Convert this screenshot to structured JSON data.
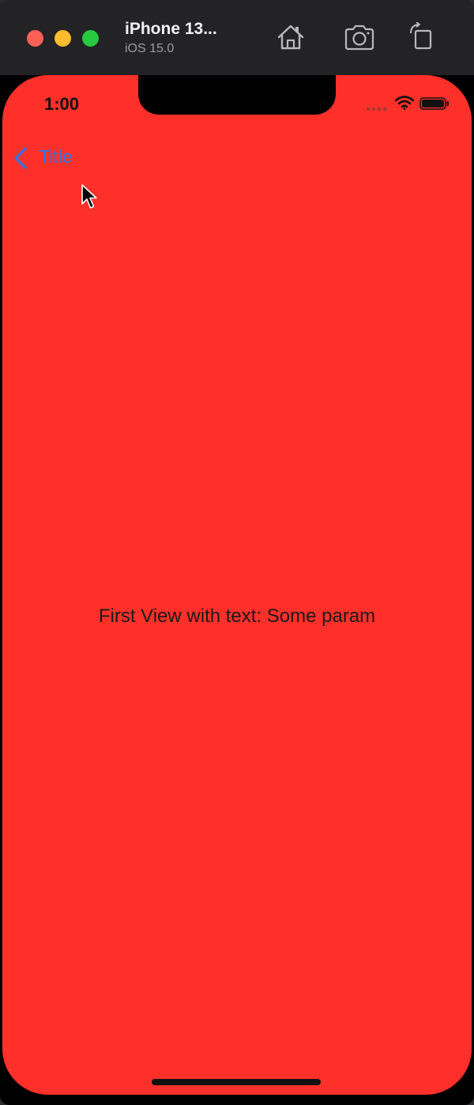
{
  "simulator": {
    "device_name": "iPhone 13...",
    "os_version": "iOS 15.0",
    "traffic_colors": {
      "close": "#fe5f57",
      "minimize": "#febc2e",
      "zoom": "#28c840"
    },
    "toolbar_icons": [
      "home-icon",
      "screenshot-icon",
      "rotate-icon"
    ]
  },
  "status_bar": {
    "time": "1:00",
    "icons": [
      "signal-icon",
      "wifi-icon",
      "battery-icon"
    ]
  },
  "nav_bar": {
    "back_label": "Title",
    "accent_color": "#2f74e6"
  },
  "content": {
    "text": "First View with text: Some param",
    "background_color": "#ff302a"
  }
}
